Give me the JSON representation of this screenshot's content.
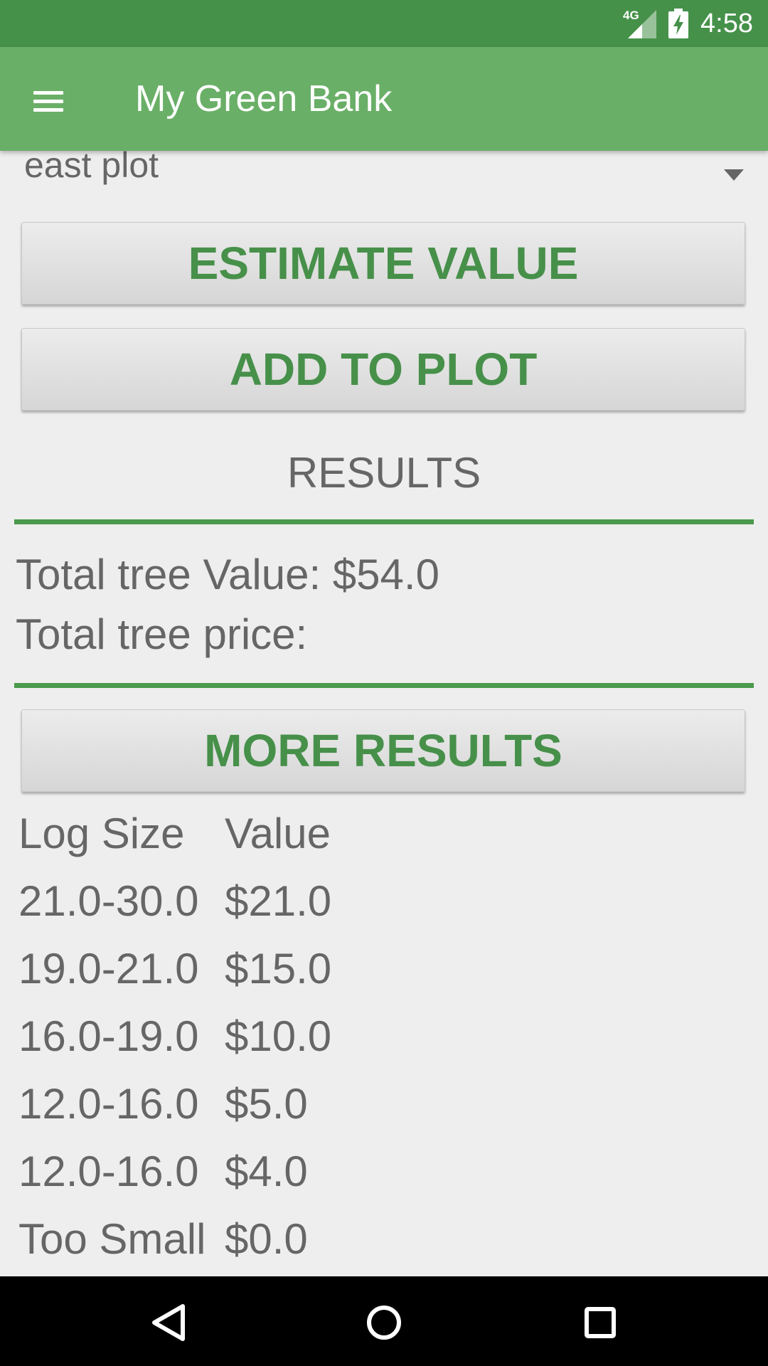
{
  "status_bar": {
    "network_label": "4G",
    "time": "4:58"
  },
  "app_bar": {
    "menu_icon": "hamburger-icon",
    "title": "My Green Bank"
  },
  "plot_selector": {
    "selected": "east plot",
    "arrow_icon": "dropdown-arrow-icon"
  },
  "buttons": {
    "estimate": "ESTIMATE VALUE",
    "add_to_plot": "ADD TO PLOT",
    "more_results": "MORE RESULTS"
  },
  "results": {
    "heading": "RESULTS",
    "total_value": "Total tree Value: $54.0",
    "total_price": "Total tree price:"
  },
  "log_table": {
    "headers": [
      "Log Size",
      "Value"
    ],
    "rows": [
      [
        "21.0-30.0",
        "$21.0"
      ],
      [
        "19.0-21.0",
        "$15.0"
      ],
      [
        "16.0-19.0",
        "$10.0"
      ],
      [
        "12.0-16.0",
        "$5.0"
      ],
      [
        "12.0-16.0",
        "$4.0"
      ],
      [
        "Too Small",
        "$0.0"
      ]
    ]
  },
  "nav_bar": {
    "back_icon": "back-icon",
    "home_icon": "home-icon",
    "recents_icon": "recents-icon"
  },
  "colors": {
    "status_bar": "#46914a",
    "app_bar": "#6aaf67",
    "accent": "#47904a",
    "text_gray": "#666666",
    "background": "#eeeeee"
  }
}
